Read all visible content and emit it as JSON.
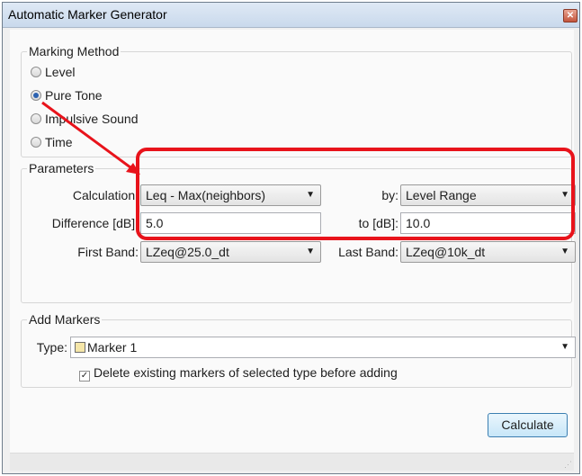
{
  "window": {
    "title": "Automatic Marker Generator"
  },
  "marking_method": {
    "title": "Marking Method",
    "options": [
      {
        "label": "Level",
        "selected": false
      },
      {
        "label": "Pure Tone",
        "selected": true
      },
      {
        "label": "Impulsive Sound",
        "selected": false
      },
      {
        "label": "Time",
        "selected": false
      }
    ]
  },
  "parameters": {
    "title": "Parameters",
    "calculation_label": "Calculation:",
    "calculation_value": "Leq - Max(neighbors)",
    "by_label": "by:",
    "by_value": "Level Range",
    "difference_label": "Difference [dB]:",
    "difference_value": "5.0",
    "to_label": "to [dB]:",
    "to_value": "10.0",
    "first_band_label": "First Band:",
    "first_band_value": "LZeq@25.0_dt",
    "last_band_label": "Last Band:",
    "last_band_value": "LZeq@10k_dt"
  },
  "add_markers": {
    "title": "Add Markers",
    "type_label": "Type:",
    "type_value": "Marker 1",
    "delete_label": "Delete existing markers of selected type before adding",
    "delete_checked": true
  },
  "buttons": {
    "calculate": "Calculate"
  },
  "annotation": {
    "color": "#e8131b"
  }
}
